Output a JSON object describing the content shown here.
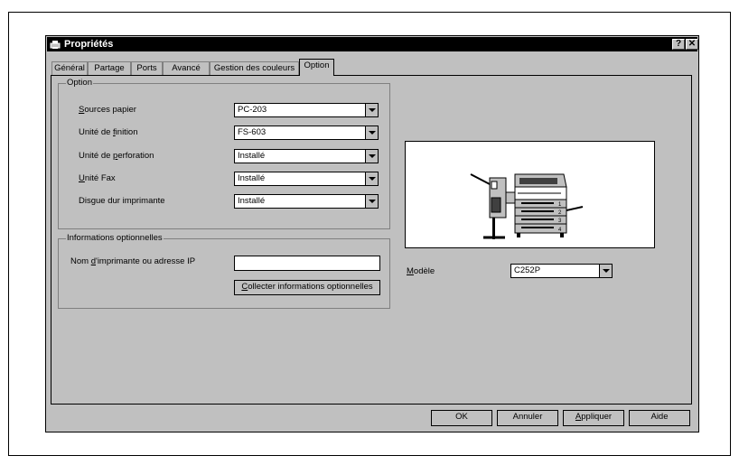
{
  "window": {
    "title": "Propriétés",
    "help_btn": "?",
    "close_btn": "✕"
  },
  "tabs": [
    {
      "label": "Général"
    },
    {
      "label": "Partage"
    },
    {
      "label": "Ports"
    },
    {
      "label": "Avancé"
    },
    {
      "label": "Gestion des couleurs"
    },
    {
      "label": "Option"
    }
  ],
  "option_group": {
    "title": "Option",
    "rows": [
      {
        "label_pre": "",
        "label_ul": "S",
        "label_post": "ources papier",
        "value": "PC-203"
      },
      {
        "label_pre": "Unité de ",
        "label_ul": "f",
        "label_post": "inition",
        "value": "FS-603"
      },
      {
        "label_pre": "Unité de ",
        "label_ul": "p",
        "label_post": "erforation",
        "value": "Installé"
      },
      {
        "label_pre": "",
        "label_ul": "U",
        "label_post": "nité Fax",
        "value": "Installé"
      },
      {
        "label_pre": "Disgue dur imprimante",
        "label_ul": "",
        "label_post": "",
        "value": "Installé"
      }
    ]
  },
  "info_group": {
    "title": "Informations optionnelles",
    "ip_label_pre": "Nom ",
    "ip_label_ul": "d",
    "ip_label_post": "'imprimante ou adresse IP",
    "ip_value": "",
    "collect_ul": "C",
    "collect_post": "ollecter informations optionnelles"
  },
  "model": {
    "label_ul": "M",
    "label_post": "odèle",
    "value": "C252P"
  },
  "footer": {
    "ok": "OK",
    "cancel": "Annuler",
    "apply_ul": "A",
    "apply_post": "ppliquer",
    "help": "Aide"
  },
  "icons": {
    "window_icon": "printer-properties-icon",
    "preview": "printer-device-image",
    "tray_numbers": [
      "1",
      "2",
      "3",
      "4"
    ]
  }
}
